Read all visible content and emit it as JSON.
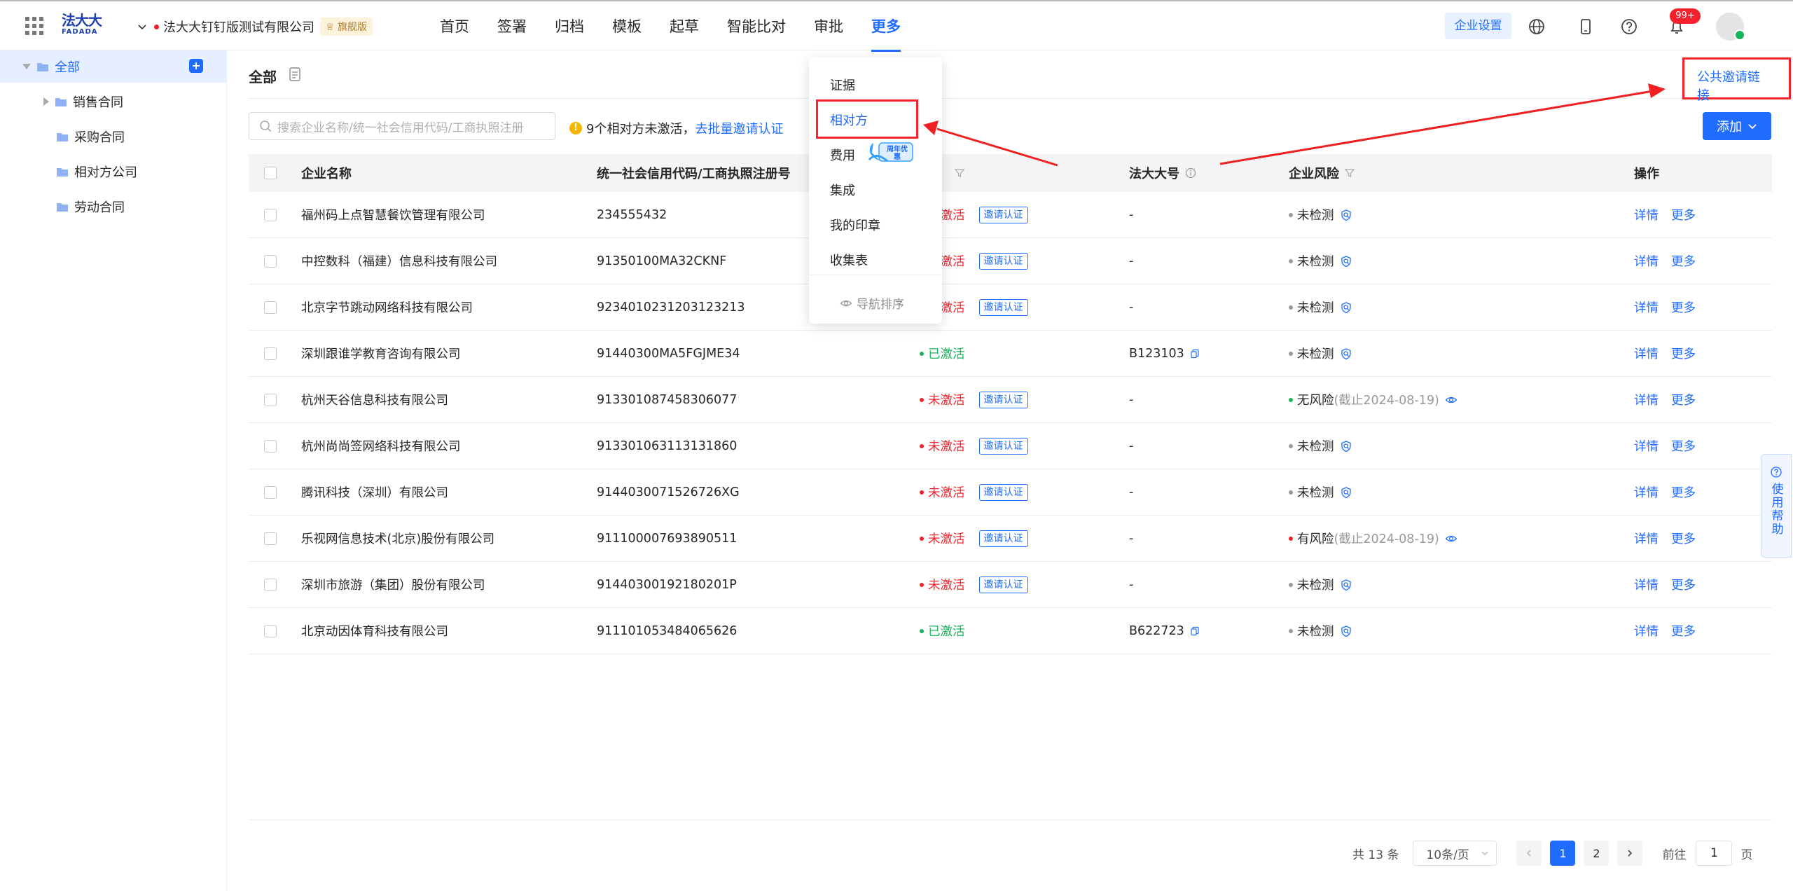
{
  "app": {
    "logo_cn": "法大大",
    "logo_en": "FADADA",
    "company_name": "法大大钉钉版测试有限公司",
    "edition_badge": "旗舰版"
  },
  "nav": {
    "items": [
      "首页",
      "签署",
      "归档",
      "模板",
      "起草",
      "智能比对",
      "审批",
      "更多"
    ],
    "active_index": 7
  },
  "header_right": {
    "settings_label": "企业设置",
    "notif_count": "99+"
  },
  "sidebar": {
    "root": "全部",
    "items": [
      "销售合同",
      "采购合同",
      "相对方公司",
      "劳动合同"
    ]
  },
  "main": {
    "title": "全部",
    "invite_link": "公共邀请链接",
    "search_placeholder": "搜索企业名称/统一社会信用代码/工商执照注册",
    "warn_text": "9个相对方未激活，",
    "warn_link": "去批量邀请认证",
    "add_label": "添加"
  },
  "table": {
    "headers": {
      "name": "企业名称",
      "code": "统一社会信用代码/工商执照注册号",
      "fdd": "法大大号",
      "risk": "企业风险",
      "ops": "操作"
    },
    "rows": [
      {
        "name": "福州码上点智慧餐饮管理有限公司",
        "code": "234555432",
        "status": "未激活",
        "fdd": "-",
        "risk": "未检测",
        "risk_note": ""
      },
      {
        "name": "中控数科（福建）信息科技有限公司",
        "code": "91350100MA32CKNF",
        "status": "未激活",
        "fdd": "-",
        "risk": "未检测",
        "risk_note": ""
      },
      {
        "name": "北京字节跳动网络科技有限公司",
        "code": "9234010231203123213",
        "status": "未激活",
        "fdd": "-",
        "risk": "未检测",
        "risk_note": ""
      },
      {
        "name": "深圳跟谁学教育咨询有限公司",
        "code": "91440300MA5FGJME34",
        "status": "已激活",
        "fdd": "B123103",
        "risk": "未检测",
        "risk_note": ""
      },
      {
        "name": "杭州天谷信息科技有限公司",
        "code": "913301087458306077",
        "status": "未激活",
        "fdd": "-",
        "risk": "无风险",
        "risk_note": "(截止2024-08-19)"
      },
      {
        "name": "杭州尚尚签网络科技有限公司",
        "code": "913301063113131860",
        "status": "未激活",
        "fdd": "-",
        "risk": "未检测",
        "risk_note": ""
      },
      {
        "name": "腾讯科技（深圳）有限公司",
        "code": "9144030071526726XG",
        "status": "未激活",
        "fdd": "-",
        "risk": "未检测",
        "risk_note": ""
      },
      {
        "name": "乐视网信息技术(北京)股份有限公司",
        "code": "911100007693890511",
        "status": "未激活",
        "fdd": "-",
        "risk": "有风险",
        "risk_note": "(截止2024-08-19)"
      },
      {
        "name": "深圳市旅游（集团）股份有限公司",
        "code": "91440300192180201P",
        "status": "未激活",
        "fdd": "-",
        "risk": "未检测",
        "risk_note": ""
      },
      {
        "name": "北京动因体育科技有限公司",
        "code": "911101053484065626",
        "status": "已激活",
        "fdd": "B622723",
        "risk": "未检测",
        "risk_note": ""
      }
    ],
    "invite_tag": "邀请认证",
    "op_detail": "详情",
    "op_more": "更多"
  },
  "pager": {
    "total": "共 13 条",
    "page_size": "10条/页",
    "pages": [
      "1",
      "2"
    ],
    "current": "1",
    "goto_label": "前往",
    "goto_value": "1",
    "page_unit": "页"
  },
  "dropdown": {
    "items": [
      "证据",
      "相对方",
      "费用",
      "集成",
      "我的印章",
      "收集表"
    ],
    "active_index": 1,
    "sort_label": "导航排序",
    "promo_text": "周年优惠"
  },
  "help": {
    "label": "使用帮助"
  },
  "colors": {
    "primary": "#1f6cff",
    "danger": "#f5222d",
    "success": "#19b35b",
    "annotation": "#f5222d"
  }
}
